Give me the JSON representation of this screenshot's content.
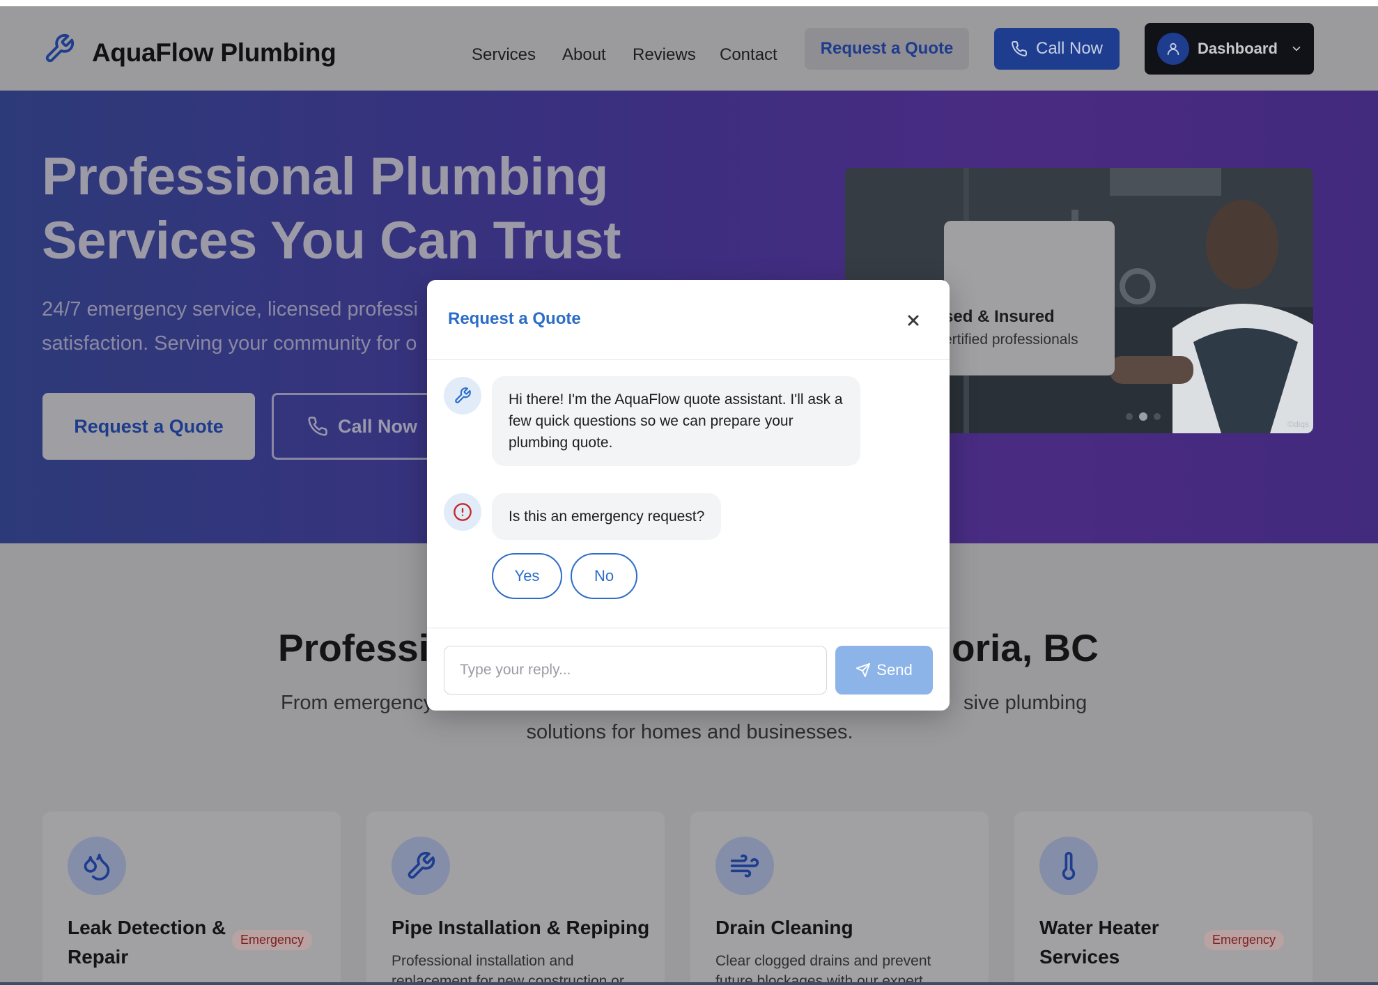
{
  "brand": {
    "name": "AquaFlow Plumbing",
    "icon": "wrench-icon"
  },
  "nav": {
    "links": [
      "Services",
      "About",
      "Reviews",
      "Contact"
    ],
    "quote_label": "Request a Quote",
    "call_label": "Call Now",
    "dashboard_label": "Dashboard"
  },
  "hero": {
    "title_line1": "Professional Plumbing",
    "title_line2": "Services You Can Trust",
    "subtitle_line1": "24/7 emergency service, licensed professi",
    "subtitle_line2": "satisfaction. Serving your community for o",
    "quote_label": "Request a Quote",
    "call_label": "Call Now",
    "badge_title": "sed & Insured",
    "badge_sub": "ertified professionals",
    "watermark": "©diqs"
  },
  "section": {
    "title_left": "Professi",
    "title_right": "oria, BC",
    "subtitle_line1_left": "From emergency",
    "subtitle_line1_right": "sive plumbing",
    "subtitle_line2": "solutions for homes and businesses."
  },
  "services": [
    {
      "title": "Leak Detection & Repair",
      "badge": "Emergency",
      "icon": "droplets-icon",
      "desc": ""
    },
    {
      "title": "Pipe Installation & Repiping",
      "badge": "",
      "icon": "wrench-icon",
      "desc": "Professional installation and replacement for new construction or"
    },
    {
      "title": "Drain Cleaning",
      "badge": "",
      "icon": "wind-icon",
      "desc": "Clear clogged drains and prevent future blockages with our expert"
    },
    {
      "title": "Water Heater Services",
      "badge": "Emergency",
      "icon": "thermometer-icon",
      "desc": ""
    }
  ],
  "modal": {
    "title": "Request a Quote",
    "messages": [
      {
        "icon": "wrench-icon",
        "text": "Hi there! I'm the AquaFlow quote assistant. I'll ask a few quick questions so we can prepare your plumbing quote."
      },
      {
        "icon": "alert-circle-icon",
        "text": "Is this an emergency request?"
      }
    ],
    "choices": [
      "Yes",
      "No"
    ],
    "input_placeholder": "Type your reply...",
    "send_label": "Send"
  },
  "colors": {
    "primary": "#2c6dc7",
    "navy": "#1e3d8f",
    "alert": "#c62828"
  }
}
